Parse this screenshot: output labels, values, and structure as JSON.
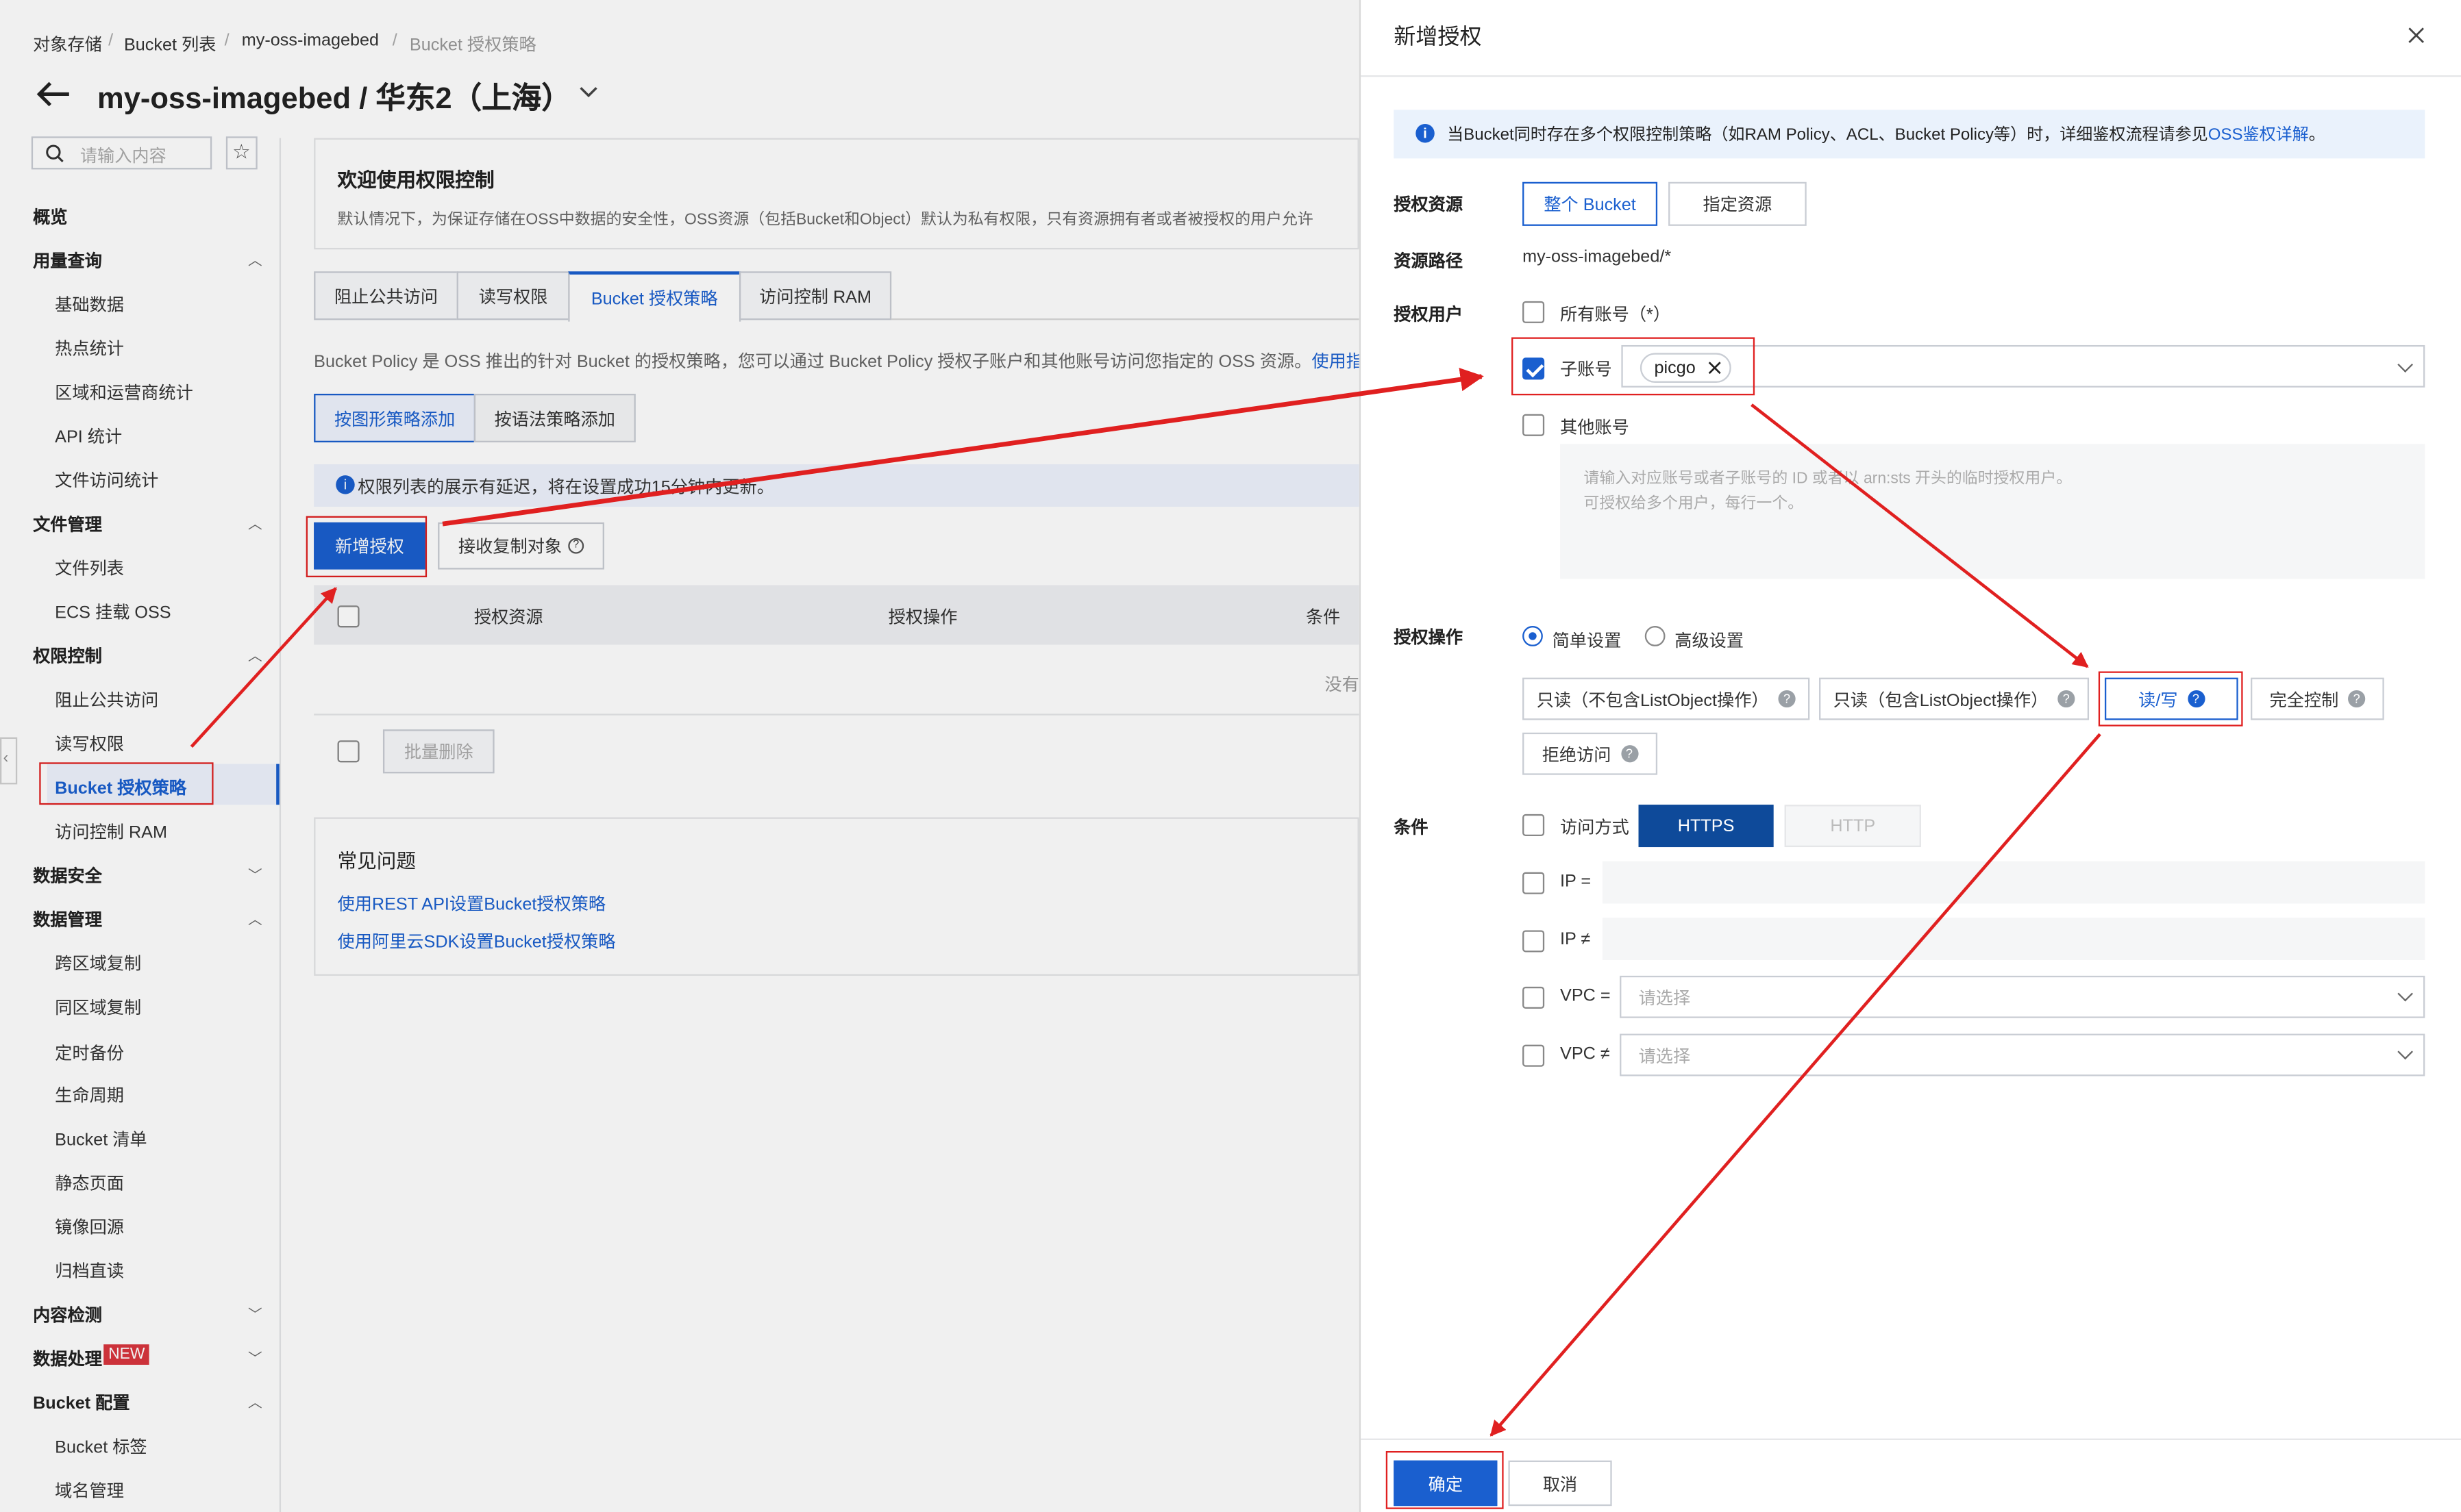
{
  "breadcrumb": [
    "对象存储",
    "Bucket 列表",
    "my-oss-imagebed",
    "Bucket 授权策略"
  ],
  "header": {
    "title": "my-oss-imagebed / 华东2（上海）"
  },
  "search": {
    "placeholder": "请输入内容"
  },
  "sidebar": {
    "overview": "概览",
    "groups": [
      {
        "label": "用量查询",
        "items": [
          "基础数据",
          "热点统计",
          "区域和运营商统计",
          "API 统计",
          "文件访问统计"
        ]
      },
      {
        "label": "文件管理",
        "items": [
          "文件列表",
          "ECS 挂载 OSS"
        ]
      },
      {
        "label": "权限控制",
        "items": [
          "阻止公共访问",
          "读写权限",
          "Bucket 授权策略",
          "访问控制 RAM"
        ]
      },
      {
        "label": "数据安全",
        "items": []
      },
      {
        "label": "数据管理",
        "items": [
          "跨区域复制",
          "同区域复制",
          "定时备份",
          "生命周期",
          "Bucket 清单",
          "静态页面",
          "镜像回源",
          "归档直读"
        ]
      },
      {
        "label": "内容检测",
        "items": []
      },
      {
        "label": "数据处理",
        "badge": "NEW",
        "items": []
      },
      {
        "label": "Bucket 配置",
        "items": [
          "Bucket 标签",
          "域名管理"
        ]
      }
    ]
  },
  "main": {
    "welcome_title": "欢迎使用权限控制",
    "welcome_desc": "默认情况下，为保证存储在OSS中数据的安全性，OSS资源（包括Bucket和Object）默认为私有权限，只有资源拥有者或者被授权的用户允许",
    "tabs": [
      "阻止公共访问",
      "读写权限",
      "Bucket 授权策略",
      "访问控制 RAM"
    ],
    "policy_desc": "Bucket Policy 是 OSS 推出的针对 Bucket 的授权策略，您可以通过 Bucket Policy 授权子账户和其他账号访问您指定的 OSS 资源。",
    "guide_link": "使用指南",
    "add_mode_graphic": "按图形策略添加",
    "add_mode_syntax": "按语法策略添加",
    "delay_notice": "权限列表的展示有延迟，将在设置成功15分钟内更新。",
    "new_auth_button": "新增授权",
    "receive_copy_button": "接收复制对象",
    "table_headers": [
      "授权资源",
      "授权操作",
      "条件"
    ],
    "empty_text": "没有",
    "batch_delete": "批量删除",
    "faq_title": "常见问题",
    "faq_links": [
      "使用REST API设置Bucket授权策略",
      "使用阿里云SDK设置Bucket授权策略"
    ]
  },
  "drawer": {
    "title": "新增授权",
    "info": "当Bucket同时存在多个权限控制策略（如RAM Policy、ACL、Bucket Policy等）时，详细鉴权流程请参见",
    "info_link": "OSS鉴权详解",
    "info_end": "。",
    "resource_label": "授权资源",
    "resource_options": [
      "整个 Bucket",
      "指定资源"
    ],
    "path_label": "资源路径",
    "path_value": "my-oss-imagebed/*",
    "user_label": "授权用户",
    "all_accounts": "所有账号（*）",
    "sub_account": "子账号",
    "sub_account_tag": "picgo",
    "other_accounts": "其他账号",
    "other_placeholder_1": "请输入对应账号或者子账号的 ID 或者以 arn:sts 开头的临时授权用户。",
    "other_placeholder_2": "可授权给多个用户，每行一个。",
    "op_label": "授权操作",
    "op_modes": [
      "简单设置",
      "高级设置"
    ],
    "op_buttons": [
      "只读（不包含ListObject操作）",
      "只读（包含ListObject操作）",
      "读/写",
      "完全控制",
      "拒绝访问"
    ],
    "cond_label": "条件",
    "access_method": "访问方式",
    "protocols": [
      "HTTPS",
      "HTTP"
    ],
    "ip_eq": "IP =",
    "ip_ne": "IP ≠",
    "vpc_eq": "VPC =",
    "vpc_ne": "VPC ≠",
    "select_placeholder": "请选择",
    "confirm": "确定",
    "cancel": "取消"
  },
  "colors": {
    "primary": "#1a5fcf",
    "annotation": "#e02020",
    "badge": "#d9363e"
  }
}
